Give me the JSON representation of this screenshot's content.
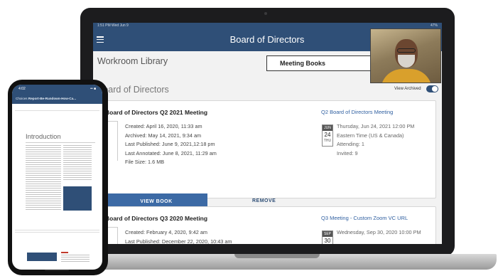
{
  "laptop": {
    "status_left": "1:51 PM  Wed Jun 9",
    "status_right": "47%",
    "app_title": "Board of Directors",
    "menu_icon": "hamburger-icon",
    "workroom_library": "Workroom Library",
    "tab_meeting_books": "Meeting Books",
    "section_title": "Board of Directors",
    "view_archived": "View Archived",
    "cards": [
      {
        "title": "Board of Directors Q2 2021 Meeting",
        "link": "Q2 Board of Directors Meeting",
        "created": "Created: April 16, 2020, 11:33 am",
        "archived": "Archived: May 14, 2021, 9:34 am",
        "last_published": "Last Published: June 9, 2021,12:18 pm",
        "last_annotated": "Last Annotated: June 8, 2021, 11:29 am",
        "file_size": "File Size: 1.6 MB",
        "cal_month": "JUN",
        "cal_day": "24",
        "cal_dow": "THU",
        "event_date": "Thursday, Jun 24, 2021 12:00 PM",
        "event_tz": "Eastern Time (US & Canada)",
        "attending": "Attending: 1",
        "invited": "Invited: 9",
        "view_book": "VIEW BOOK",
        "remove": "REMOVE"
      },
      {
        "title": "Board of Directors Q3 2020 Meeting",
        "link": "Q3 Meeting - Custom Zoom VC URL",
        "created": "Created: February 4, 2020, 9:42 am",
        "last_published": "Last Published: December 22, 2020, 10:43 am",
        "cal_month": "SEP",
        "cal_day": "30",
        "event_date": "Wednesday, Sep 30, 2020 10:00 PM"
      }
    ]
  },
  "phone": {
    "status_left": "4:02",
    "status_right": "•• ■",
    "header_prefix": "Choices",
    "header_title": "Report-Be-Rundown-How-Ca...",
    "intro": "Introduction"
  },
  "colors": {
    "brand_navy": "#2f4f77",
    "button_blue": "#3c6aa5",
    "link_blue": "#2f5fa0"
  }
}
